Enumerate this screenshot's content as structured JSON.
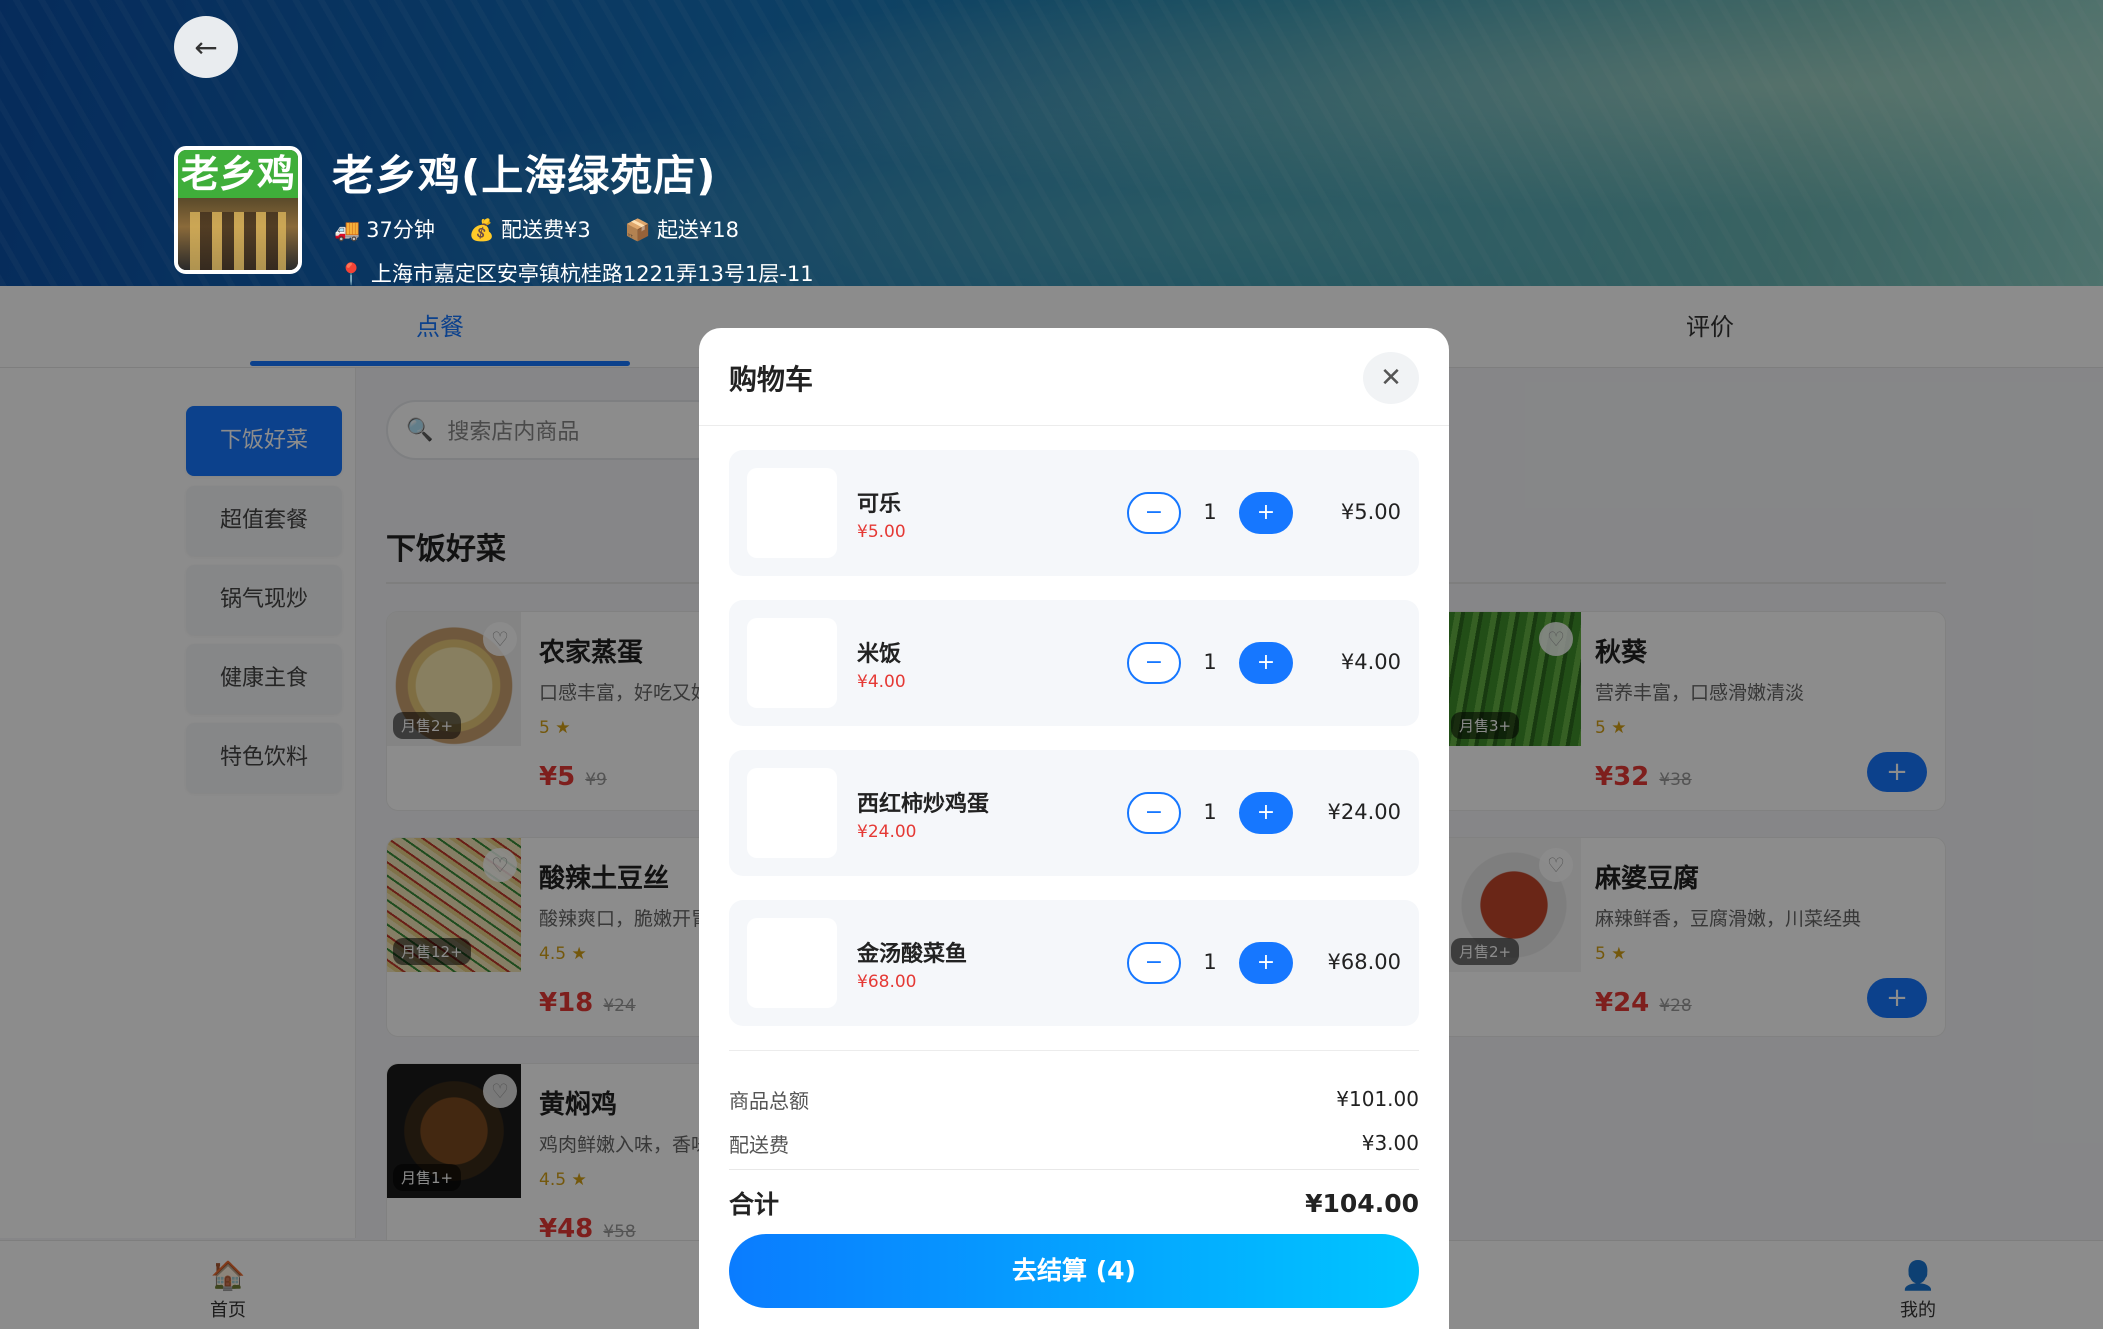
{
  "shop": {
    "name": "老乡鸡(上海绿苑店)",
    "delivery_time": "37分钟",
    "delivery_fee": "配送费¥3",
    "min_order": "起送¥18",
    "address": "上海市嘉定区安亭镇杭桂路1221弄13号1层-11",
    "logo_text": "老乡鸡"
  },
  "tabs": {
    "order": "点餐",
    "review": "评价"
  },
  "categories": [
    "下饭好菜",
    "超值套餐",
    "锅气现炒",
    "健康主食",
    "特色饮料"
  ],
  "search": {
    "placeholder": "搜索店内商品"
  },
  "section": {
    "title": "下饭好菜"
  },
  "menu": [
    {
      "name": "农家蒸蛋",
      "desc": "口感丰富，好吃又好",
      "rating": "5",
      "price": "¥5",
      "original": "¥9",
      "sold": "月售2+"
    },
    {
      "name": "秋葵",
      "desc": "营养丰富，口感滑嫩清淡",
      "rating": "5",
      "price": "¥32",
      "original": "¥38",
      "sold": "月售3+"
    },
    {
      "name": "酸辣土豆丝",
      "desc": "酸辣爽口，脆嫩开胃",
      "rating": "4.5",
      "price": "¥18",
      "original": "¥24",
      "sold": "月售12+"
    },
    {
      "name": "麻婆豆腐",
      "desc": "麻辣鲜香，豆腐滑嫩，川菜经典",
      "rating": "5",
      "price": "¥24",
      "original": "¥28",
      "sold": "月售2+"
    },
    {
      "name": "黄焖鸡",
      "desc": "鸡肉鲜嫩入味，香味",
      "rating": "4.5",
      "price": "¥48",
      "original": "¥58",
      "sold": "月售1+"
    }
  ],
  "bottom_nav": {
    "home": "首页",
    "mine": "我的"
  },
  "cart": {
    "title": "购物车",
    "items": [
      {
        "name": "可乐",
        "unit_price": "¥5.00",
        "qty": "1",
        "subtotal": "¥5.00"
      },
      {
        "name": "米饭",
        "unit_price": "¥4.00",
        "qty": "1",
        "subtotal": "¥4.00"
      },
      {
        "name": "西红柿炒鸡蛋",
        "unit_price": "¥24.00",
        "qty": "1",
        "subtotal": "¥24.00"
      },
      {
        "name": "金汤酸菜鱼",
        "unit_price": "¥68.00",
        "qty": "1",
        "subtotal": "¥68.00"
      }
    ],
    "goods_total_label": "商品总额",
    "goods_total": "¥101.00",
    "delivery_label": "配送费",
    "delivery": "¥3.00",
    "total_label": "合计",
    "total": "¥104.00",
    "checkout_label": "去结算 (4)"
  },
  "colors": {
    "accent": "#1677ff",
    "price": "#e53935",
    "checkout_gradient_start": "#0a7cff",
    "checkout_gradient_end": "#00c6ff"
  }
}
